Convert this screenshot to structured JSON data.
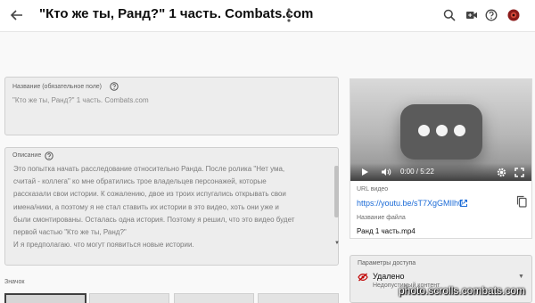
{
  "header": {
    "title": "\"Кто же ты, Ранд?\" 1 часть. Combats.com",
    "back_icon": "arrow-left-icon",
    "icons": [
      "search-icon",
      "video-camera-icon",
      "help-icon",
      "avatar"
    ]
  },
  "form": {
    "title_field": {
      "label": "Название (обязательное поле)",
      "value": "\"Кто же ты, Ранд?\" 1 часть. Combats.com"
    },
    "description_field": {
      "label": "Описание",
      "lines": [
        "Это попытка начать расследование относительно Ранда. После ролика \"Нет ума,",
        "считай - коллега\" ко мне обратились трое владельцев персонажей, которые",
        "рассказали свои истории. К сожалению, двое из троих испугались открывать свои",
        "имена/ники, а поэтому я не стал ставить их истории в это видео, хоть они уже и",
        "были смонтированы. Осталась одна история. Поэтому я решил, что это видео будет",
        "первой частью \"Кто же ты, Ранд?\"",
        "И я предполагаю. что могут появиться новые истории."
      ]
    },
    "thumbnails_label": "Значок"
  },
  "video_card": {
    "time": "0:00 / 5:22",
    "url_label": "URL видео",
    "url": "https://youtu.be/sT7XgGMIlh0",
    "filename_label": "Название файла",
    "filename": "Ранд 1 часть.mp4"
  },
  "access": {
    "label": "Параметры доступа",
    "value": "Удалено",
    "sub": "Недопустимый контент"
  },
  "colors": {
    "link": "#1a6ad6",
    "removed_icon": "#c00000",
    "avatar": "#8b1a1a"
  },
  "watermark": "photo.scrolls.combats.com"
}
